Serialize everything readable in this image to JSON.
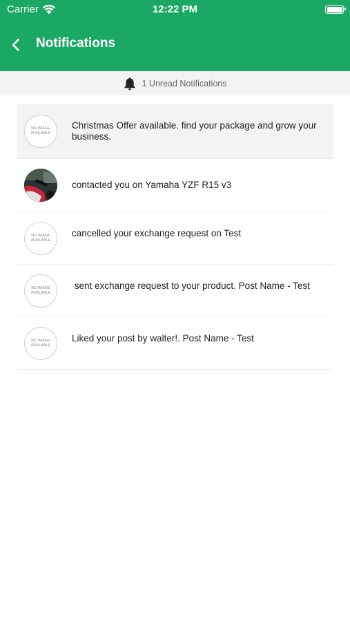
{
  "status_bar": {
    "carrier": "Carrier",
    "time": "12:22 PM"
  },
  "nav": {
    "title": "Notifications"
  },
  "unread_bar": {
    "text": "1 Unread Notifications"
  },
  "notifications": [
    {
      "text": "Christmas Offer available. find your package and grow your business.",
      "avatar": "NO IMAGE AVAILABLE",
      "unread": true
    },
    {
      "text": "contacted you on Yamaha YZF R15 v3",
      "avatar": "photo",
      "unread": false
    },
    {
      "text": "cancelled your exchange request on Test",
      "avatar": "NO IMAGE AVAILABLE",
      "unread": false
    },
    {
      "text": " sent exchange request to your product. Post Name - Test",
      "avatar": "NO IMAGE AVAILABLE",
      "unread": false
    },
    {
      "text": "Liked your post by walter!. Post Name - Test",
      "avatar": "NO IMAGE AVAILABLE",
      "unread": false
    }
  ],
  "colors": {
    "header": "#1aa864",
    "unread_bg": "#f3f3f3"
  },
  "icons": {
    "back": "chevron-left-icon",
    "bell": "bell-icon",
    "wifi": "wifi-icon",
    "battery": "battery-icon"
  }
}
